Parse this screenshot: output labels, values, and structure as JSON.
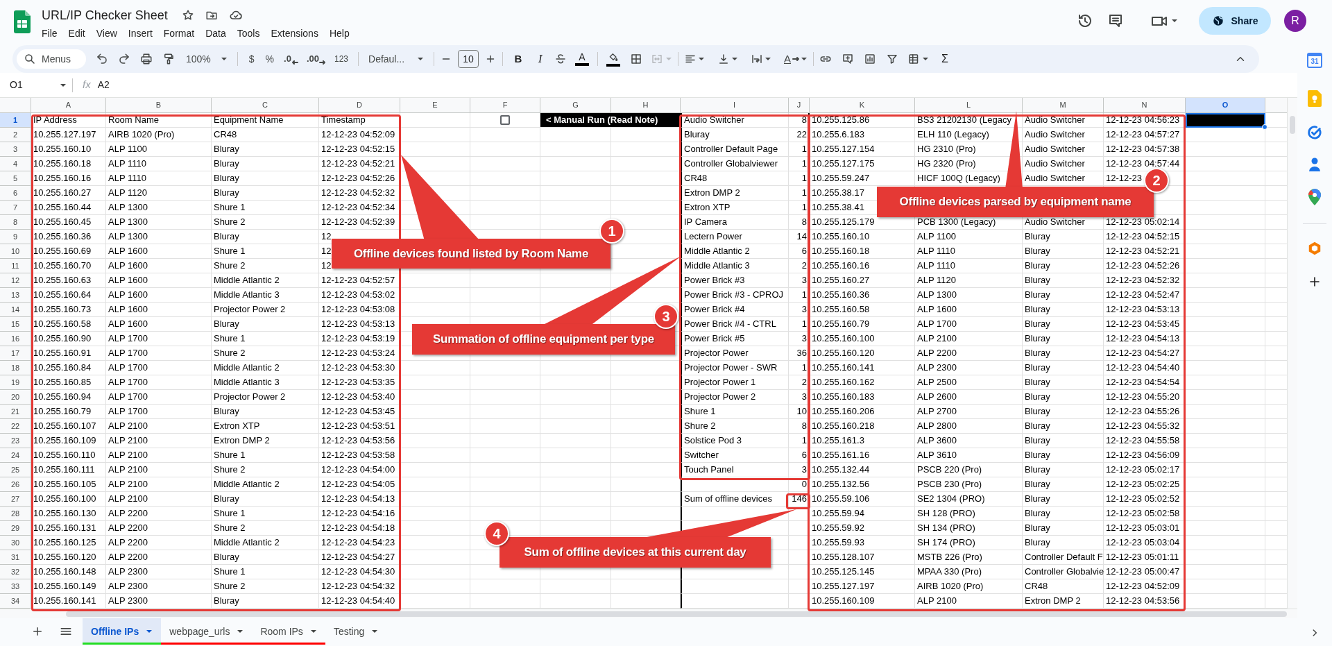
{
  "app": {
    "title": "URL/IP Checker Sheet",
    "menu": [
      "File",
      "Edit",
      "View",
      "Insert",
      "Format",
      "Data",
      "Tools",
      "Extensions",
      "Help"
    ],
    "share": "Share",
    "avatar": "R"
  },
  "toolbar": {
    "search": "Menus",
    "zoom": "100%",
    "currency": "$",
    "percent": "%",
    "decrease_decimal": ".0",
    "increase_decimal": ".00",
    "number_format": "123",
    "font": "Defaul...",
    "font_size": "10",
    "bold": "B",
    "italic": "I",
    "text_color": "A",
    "text_rotation": "A",
    "functions": "Σ"
  },
  "formula_bar": {
    "cell": "O1",
    "label": "fx",
    "formula": "A2"
  },
  "columns": [
    {
      "label": "A",
      "selected": false
    },
    {
      "label": "B",
      "selected": false
    },
    {
      "label": "C",
      "selected": false
    },
    {
      "label": "D",
      "selected": false
    },
    {
      "label": "E",
      "selected": false
    },
    {
      "label": "F",
      "selected": false
    },
    {
      "label": "G",
      "selected": false
    },
    {
      "label": "H",
      "selected": false
    },
    {
      "label": "I",
      "selected": false
    },
    {
      "label": "J",
      "selected": false
    },
    {
      "label": "K",
      "selected": false
    },
    {
      "label": "L",
      "selected": false
    },
    {
      "label": "M",
      "selected": false
    },
    {
      "label": "N",
      "selected": false
    },
    {
      "label": "O",
      "selected": true
    }
  ],
  "row_numbers": [
    {
      "label": "1",
      "selected": true
    },
    {
      "label": "2",
      "selected": false
    },
    {
      "label": "3",
      "selected": false
    },
    {
      "label": "4",
      "selected": false
    },
    {
      "label": "5",
      "selected": false
    },
    {
      "label": "6",
      "selected": false
    },
    {
      "label": "7",
      "selected": false
    },
    {
      "label": "8",
      "selected": false
    },
    {
      "label": "9",
      "selected": false
    },
    {
      "label": "10",
      "selected": false
    },
    {
      "label": "11",
      "selected": false
    },
    {
      "label": "12",
      "selected": false
    },
    {
      "label": "13",
      "selected": false
    },
    {
      "label": "14",
      "selected": false
    },
    {
      "label": "15",
      "selected": false
    },
    {
      "label": "16",
      "selected": false
    },
    {
      "label": "17",
      "selected": false
    },
    {
      "label": "18",
      "selected": false
    },
    {
      "label": "19",
      "selected": false
    },
    {
      "label": "20",
      "selected": false
    },
    {
      "label": "21",
      "selected": false
    },
    {
      "label": "22",
      "selected": false
    },
    {
      "label": "23",
      "selected": false
    },
    {
      "label": "24",
      "selected": false
    },
    {
      "label": "25",
      "selected": false
    },
    {
      "label": "26",
      "selected": false
    },
    {
      "label": "27",
      "selected": false
    },
    {
      "label": "28",
      "selected": false
    },
    {
      "label": "29",
      "selected": false
    },
    {
      "label": "30",
      "selected": false
    },
    {
      "label": "31",
      "selected": false
    },
    {
      "label": "32",
      "selected": false
    },
    {
      "label": "33",
      "selected": false
    },
    {
      "label": "34",
      "selected": false
    }
  ],
  "offline_table": {
    "rows": [
      [
        "IP Address",
        "Room Name",
        "Equipment Name",
        "Timestamp"
      ],
      [
        "10.255.127.197",
        "AIRB 1020 (Pro)",
        "CR48",
        "12-12-23 04:52:09"
      ],
      [
        "10.255.160.10",
        "ALP 1100",
        "Bluray",
        "12-12-23 04:52:15"
      ],
      [
        "10.255.160.18",
        "ALP 1110",
        "Bluray",
        "12-12-23 04:52:21"
      ],
      [
        "10.255.160.16",
        "ALP 1110",
        "Bluray",
        "12-12-23 04:52:26"
      ],
      [
        "10.255.160.27",
        "ALP 1120",
        "Bluray",
        "12-12-23 04:52:32"
      ],
      [
        "10.255.160.44",
        "ALP 1300",
        "Shure 1",
        "12-12-23 04:52:34"
      ],
      [
        "10.255.160.45",
        "ALP 1300",
        "Shure 2",
        "12-12-23 04:52:39"
      ],
      [
        "10.255.160.36",
        "ALP 1300",
        "Bluray",
        "12"
      ],
      [
        "10.255.160.69",
        "ALP 1600",
        "Shure 1",
        "12"
      ],
      [
        "10.255.160.70",
        "ALP 1600",
        "Shure 2",
        "12"
      ],
      [
        "10.255.160.63",
        "ALP 1600",
        "Middle Atlantic 2",
        "12-12-23 04:52:57"
      ],
      [
        "10.255.160.64",
        "ALP 1600",
        "Middle Atlantic 3",
        "12-12-23 04:53:02"
      ],
      [
        "10.255.160.73",
        "ALP 1600",
        "Projector Power 2",
        "12-12-23 04:53:08"
      ],
      [
        "10.255.160.58",
        "ALP 1600",
        "Bluray",
        "12-12-23 04:53:13"
      ],
      [
        "10.255.160.90",
        "ALP 1700",
        "Shure 1",
        "12-12-23 04:53:19"
      ],
      [
        "10.255.160.91",
        "ALP 1700",
        "Shure 2",
        "12-12-23 04:53:24"
      ],
      [
        "10.255.160.84",
        "ALP 1700",
        "Middle Atlantic 2",
        "12-12-23 04:53:30"
      ],
      [
        "10.255.160.85",
        "ALP 1700",
        "Middle Atlantic 3",
        "12-12-23 04:53:35"
      ],
      [
        "10.255.160.94",
        "ALP 1700",
        "Projector Power 2",
        "12-12-23 04:53:40"
      ],
      [
        "10.255.160.79",
        "ALP 1700",
        "Bluray",
        "12-12-23 04:53:45"
      ],
      [
        "10.255.160.107",
        "ALP 2100",
        "Extron XTP",
        "12-12-23 04:53:51"
      ],
      [
        "10.255.160.109",
        "ALP 2100",
        "Extron DMP 2",
        "12-12-23 04:53:56"
      ],
      [
        "10.255.160.110",
        "ALP 2100",
        "Shure 1",
        "12-12-23 04:53:58"
      ],
      [
        "10.255.160.111",
        "ALP 2100",
        "Shure 2",
        "12-12-23 04:54:00"
      ],
      [
        "10.255.160.105",
        "ALP 2100",
        "Middle Atlantic 2",
        "12-12-23 04:54:05"
      ],
      [
        "10.255.160.100",
        "ALP 2100",
        "Bluray",
        "12-12-23 04:54:13"
      ],
      [
        "10.255.160.130",
        "ALP 2200",
        "Shure 1",
        "12-12-23 04:54:16"
      ],
      [
        "10.255.160.131",
        "ALP 2200",
        "Shure 2",
        "12-12-23 04:54:18"
      ],
      [
        "10.255.160.125",
        "ALP 2200",
        "Middle Atlantic 2",
        "12-12-23 04:54:23"
      ],
      [
        "10.255.160.120",
        "ALP 2200",
        "Bluray",
        "12-12-23 04:54:27"
      ],
      [
        "10.255.160.148",
        "ALP 2300",
        "Shure 1",
        "12-12-23 04:54:30"
      ],
      [
        "10.255.160.149",
        "ALP 2300",
        "Shure 2",
        "12-12-23 04:54:32"
      ],
      [
        "10.255.160.141",
        "ALP 2300",
        "Bluray",
        "12-12-23 04:54:40"
      ]
    ]
  },
  "manual_run": {
    "checked": false,
    "note": "< Manual Run (Read Note)"
  },
  "equipment_counts": {
    "rows": [
      {
        "name": "Audio Switcher",
        "count": "8"
      },
      {
        "name": "Bluray",
        "count": "22"
      },
      {
        "name": "Controller Default Page",
        "count": "1"
      },
      {
        "name": "Controller Globalviewer",
        "count": "1"
      },
      {
        "name": "CR48",
        "count": "1"
      },
      {
        "name": "Extron DMP 2",
        "count": "1"
      },
      {
        "name": "Extron XTP",
        "count": "1"
      },
      {
        "name": "IP Camera",
        "count": "8"
      },
      {
        "name": "Lectern Power",
        "count": "14"
      },
      {
        "name": "Middle Atlantic 2",
        "count": "6"
      },
      {
        "name": "Middle Atlantic 3",
        "count": "2"
      },
      {
        "name": "Power Brick #3",
        "count": "3"
      },
      {
        "name": "Power Brick #3 - CPROJ",
        "count": "1"
      },
      {
        "name": "Power Brick #4",
        "count": "3"
      },
      {
        "name": "Power Brick #4 - CTRL",
        "count": "1"
      },
      {
        "name": "Power Brick #5",
        "count": "3"
      },
      {
        "name": "Projector Power",
        "count": "36"
      },
      {
        "name": "Projector Power - SWR",
        "count": "1"
      },
      {
        "name": "Projector Power 1",
        "count": "2"
      },
      {
        "name": "Projector Power 2",
        "count": "3"
      },
      {
        "name": "Shure 1",
        "count": "10"
      },
      {
        "name": "Shure 2",
        "count": "8"
      },
      {
        "name": "Solstice Pod 3",
        "count": "1"
      },
      {
        "name": "Switcher",
        "count": "6"
      },
      {
        "name": "Touch Panel",
        "count": "3"
      }
    ],
    "blank_count": "0",
    "total_label": "Sum of offline devices",
    "total": "146"
  },
  "parsed_by_equipment": {
    "rows": [
      [
        "10.255.125.86",
        "BS3 21202130 (Legacy",
        "Audio Switcher",
        "12-12-23 04:56:23"
      ],
      [
        "10.255.6.183",
        "ELH 110 (Legacy)",
        "Audio Switcher",
        "12-12-23 04:57:27"
      ],
      [
        "10.255.127.154",
        "HG 2310 (Pro)",
        "Audio Switcher",
        "12-12-23 04:57:38"
      ],
      [
        "10.255.127.175",
        "HG 2320 (Pro)",
        "Audio Switcher",
        "12-12-23 04:57:44"
      ],
      [
        "10.255.59.247",
        "HICF 100Q (Legacy)",
        "Audio Switcher",
        "12-12-23"
      ],
      [
        "10.255.38.17"
      ],
      [
        "10.255.38.41"
      ],
      [
        "10.255.125.179",
        "PCB 1300 (Legacy)",
        "Audio Switcher",
        "12-12-23 05:02:14"
      ],
      [
        "10.255.160.10",
        "ALP 1100",
        "Bluray",
        "12-12-23 04:52:15"
      ],
      [
        "10.255.160.18",
        "ALP 1110",
        "Bluray",
        "12-12-23 04:52:21"
      ],
      [
        "10.255.160.16",
        "ALP 1110",
        "Bluray",
        "12-12-23 04:52:26"
      ],
      [
        "10.255.160.27",
        "ALP 1120",
        "Bluray",
        "12-12-23 04:52:32"
      ],
      [
        "10.255.160.36",
        "ALP 1300",
        "Bluray",
        "12-12-23 04:52:47"
      ],
      [
        "10.255.160.58",
        "ALP 1600",
        "Bluray",
        "12-12-23 04:53:13"
      ],
      [
        "10.255.160.79",
        "ALP 1700",
        "Bluray",
        "12-12-23 04:53:45"
      ],
      [
        "10.255.160.100",
        "ALP 2100",
        "Bluray",
        "12-12-23 04:54:13"
      ],
      [
        "10.255.160.120",
        "ALP 2200",
        "Bluray",
        "12-12-23 04:54:27"
      ],
      [
        "10.255.160.141",
        "ALP 2300",
        "Bluray",
        "12-12-23 04:54:40"
      ],
      [
        "10.255.160.162",
        "ALP 2500",
        "Bluray",
        "12-12-23 04:54:54"
      ],
      [
        "10.255.160.183",
        "ALP 2600",
        "Bluray",
        "12-12-23 04:55:20"
      ],
      [
        "10.255.160.206",
        "ALP 2700",
        "Bluray",
        "12-12-23 04:55:26"
      ],
      [
        "10.255.160.218",
        "ALP 2800",
        "Bluray",
        "12-12-23 04:55:32"
      ],
      [
        "10.255.161.3",
        "ALP 3600",
        "Bluray",
        "12-12-23 04:55:58"
      ],
      [
        "10.255.161.16",
        "ALP 3610",
        "Bluray",
        "12-12-23 04:56:09"
      ],
      [
        "10.255.132.44",
        "PSCB 220 (Pro)",
        "Bluray",
        "12-12-23 05:02:17"
      ],
      [
        "10.255.132.56",
        "PSCB 230 (Pro)",
        "Bluray",
        "12-12-23 05:02:25"
      ],
      [
        "10.255.59.106",
        "SE2 1304 (PRO)",
        "Bluray",
        "12-12-23 05:02:52"
      ],
      [
        "10.255.59.94",
        "SH 128 (PRO)",
        "Bluray",
        "12-12-23 05:02:58"
      ],
      [
        "10.255.59.92",
        "SH 134 (PRO)",
        "Bluray",
        "12-12-23 05:03:01"
      ],
      [
        "10.255.59.93",
        "SH 174 (PRO)",
        "Bluray",
        "12-12-23 05:03:04"
      ],
      [
        "10.255.128.107",
        "MSTB 226 (Pro)",
        "Controller Default F",
        "12-12-23 05:01:11"
      ],
      [
        "10.255.125.145",
        "MPAA 330 (Pro)",
        "Controller Globalvie",
        "12-12-23 05:00:47"
      ],
      [
        "10.255.127.197",
        "AIRB 1020 (Pro)",
        "CR48",
        "12-12-23 04:52:09"
      ],
      [
        "10.255.160.109",
        "ALP 2100",
        "Extron DMP 2",
        "12-12-23 04:53:56"
      ]
    ]
  },
  "callouts": [
    {
      "number": "1",
      "text": "Offline devices found listed by Room Name"
    },
    {
      "number": "2",
      "text": "Offline devices parsed by equipment name"
    },
    {
      "number": "3",
      "text": "Summation of offline equipment per type"
    },
    {
      "number": "4",
      "text": "Sum of offline devices at this current day"
    }
  ],
  "sheet_tabs": [
    {
      "label": "Offline IPs",
      "selected": true,
      "color": "#22dd22"
    },
    {
      "label": "webpage_urls",
      "selected": false,
      "color": "#ff0000"
    },
    {
      "label": "Room IPs",
      "selected": false,
      "color": "#ff0000"
    },
    {
      "label": "Testing",
      "selected": false
    }
  ],
  "side_panel": {
    "calendar_date": "31"
  }
}
